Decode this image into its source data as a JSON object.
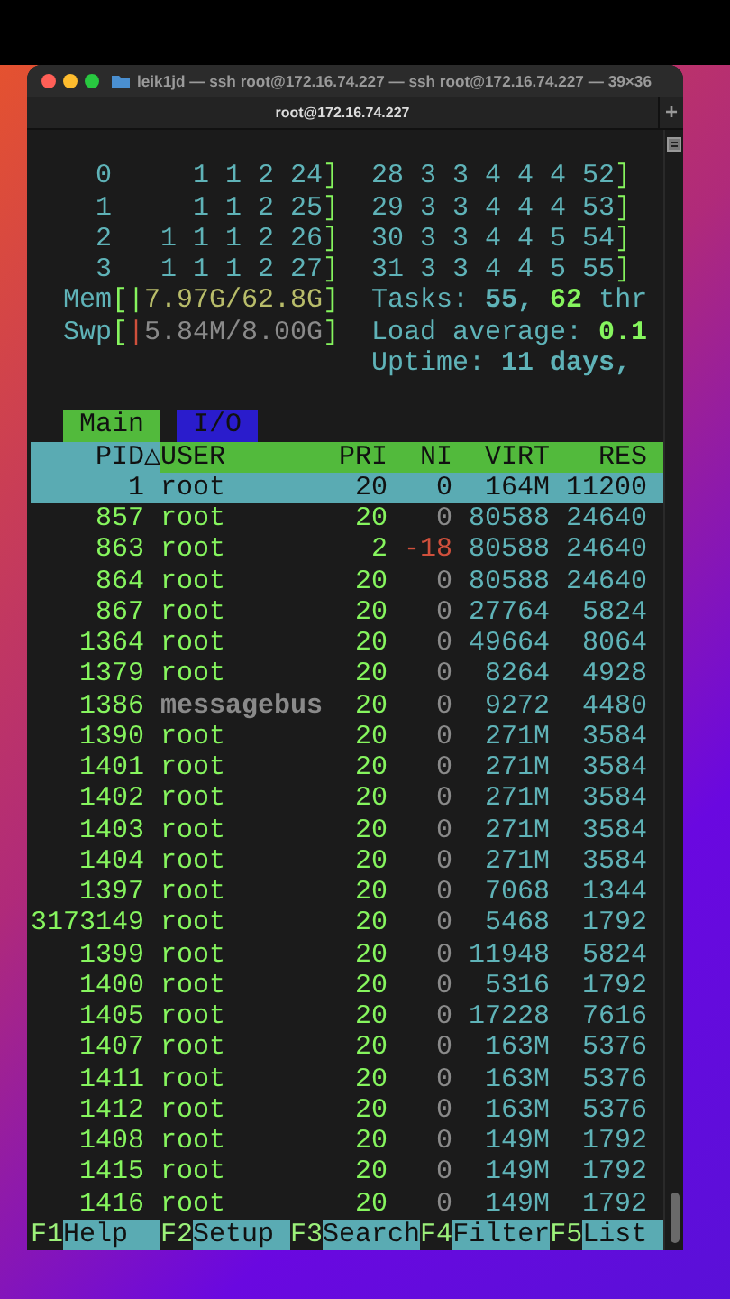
{
  "window": {
    "title": "leik1jd — ssh root@172.16.74.227 — ssh root@172.16.74.227 — 39×36",
    "tab_title": "root@172.16.74.227",
    "new_tab": "+"
  },
  "cpu_meters": [
    {
      "left": {
        "cpu": "0",
        "values": "1 1 2 24",
        "end": "]"
      },
      "right": {
        "values": "28 3 3 4 4 4 52",
        "end": "]"
      }
    },
    {
      "left": {
        "cpu": "1",
        "values": "1 1 2 25",
        "end": "]"
      },
      "right": {
        "values": "29 3 3 4 4 4 53",
        "end": "]"
      }
    },
    {
      "left": {
        "cpu": "2",
        "values": "1 1 1 2 26",
        "end": "]"
      },
      "right": {
        "values": "30 3 3 4 4 5 54",
        "end": "]"
      }
    },
    {
      "left": {
        "cpu": "3",
        "values": "1 1 1 2 27",
        "end": "]"
      },
      "right": {
        "values": "31 3 3 4 4 5 55",
        "end": "]"
      }
    }
  ],
  "memory": {
    "label": "Mem",
    "open": "[",
    "bar": "|",
    "value": "7.97G/62.8G",
    "close": "]"
  },
  "swap": {
    "label": "Swp",
    "open": "[",
    "bar": "|",
    "value": "5.84M/8.00G",
    "close": "]"
  },
  "tasks": {
    "label": "Tasks:",
    "count": "55,",
    "threads": "62",
    "unit": "thr"
  },
  "load": {
    "label": "Load average:",
    "value": "0.1"
  },
  "uptime": {
    "label": "Uptime:",
    "value": "11 days,"
  },
  "tabs": [
    {
      "label": "Main",
      "selected": true
    },
    {
      "label": "I/O",
      "selected": false
    }
  ],
  "columns": [
    {
      "label": "PID",
      "sort_mark": "△",
      "sorted": true
    },
    {
      "label": "USER",
      "sorted": false
    },
    {
      "label": "PRI",
      "sorted": false
    },
    {
      "label": "NI",
      "sorted": false
    },
    {
      "label": "VIRT",
      "sorted": false
    },
    {
      "label": "RES",
      "sorted": false
    }
  ],
  "rows": [
    {
      "pid": "1",
      "user": "root",
      "pri": "20",
      "ni": "0",
      "virt": "164M",
      "res": "11200",
      "selected": true,
      "dimmed_user": false,
      "reniced": false
    },
    {
      "pid": "857",
      "user": "root",
      "pri": "20",
      "ni": "0",
      "virt": "80588",
      "res": "24640",
      "selected": false,
      "dimmed_user": false,
      "reniced": false
    },
    {
      "pid": "863",
      "user": "root",
      "pri": "2",
      "ni": "-18",
      "virt": "80588",
      "res": "24640",
      "selected": false,
      "dimmed_user": false,
      "reniced": true
    },
    {
      "pid": "864",
      "user": "root",
      "pri": "20",
      "ni": "0",
      "virt": "80588",
      "res": "24640",
      "selected": false,
      "dimmed_user": false,
      "reniced": false
    },
    {
      "pid": "867",
      "user": "root",
      "pri": "20",
      "ni": "0",
      "virt": "27764",
      "res": "5824",
      "selected": false,
      "dimmed_user": false,
      "reniced": false
    },
    {
      "pid": "1364",
      "user": "root",
      "pri": "20",
      "ni": "0",
      "virt": "49664",
      "res": "8064",
      "selected": false,
      "dimmed_user": false,
      "reniced": false
    },
    {
      "pid": "1379",
      "user": "root",
      "pri": "20",
      "ni": "0",
      "virt": "8264",
      "res": "4928",
      "selected": false,
      "dimmed_user": false,
      "reniced": false
    },
    {
      "pid": "1386",
      "user": "messagebus",
      "pri": "20",
      "ni": "0",
      "virt": "9272",
      "res": "4480",
      "selected": false,
      "dimmed_user": true,
      "reniced": false
    },
    {
      "pid": "1390",
      "user": "root",
      "pri": "20",
      "ni": "0",
      "virt": "271M",
      "res": "3584",
      "selected": false,
      "dimmed_user": false,
      "reniced": false
    },
    {
      "pid": "1401",
      "user": "root",
      "pri": "20",
      "ni": "0",
      "virt": "271M",
      "res": "3584",
      "selected": false,
      "dimmed_user": false,
      "reniced": false
    },
    {
      "pid": "1402",
      "user": "root",
      "pri": "20",
      "ni": "0",
      "virt": "271M",
      "res": "3584",
      "selected": false,
      "dimmed_user": false,
      "reniced": false
    },
    {
      "pid": "1403",
      "user": "root",
      "pri": "20",
      "ni": "0",
      "virt": "271M",
      "res": "3584",
      "selected": false,
      "dimmed_user": false,
      "reniced": false
    },
    {
      "pid": "1404",
      "user": "root",
      "pri": "20",
      "ni": "0",
      "virt": "271M",
      "res": "3584",
      "selected": false,
      "dimmed_user": false,
      "reniced": false
    },
    {
      "pid": "1397",
      "user": "root",
      "pri": "20",
      "ni": "0",
      "virt": "7068",
      "res": "1344",
      "selected": false,
      "dimmed_user": false,
      "reniced": false
    },
    {
      "pid": "3173149",
      "user": "root",
      "pri": "20",
      "ni": "0",
      "virt": "5468",
      "res": "1792",
      "selected": false,
      "dimmed_user": false,
      "reniced": false
    },
    {
      "pid": "1399",
      "user": "root",
      "pri": "20",
      "ni": "0",
      "virt": "11948",
      "res": "5824",
      "selected": false,
      "dimmed_user": false,
      "reniced": false
    },
    {
      "pid": "1400",
      "user": "root",
      "pri": "20",
      "ni": "0",
      "virt": "5316",
      "res": "1792",
      "selected": false,
      "dimmed_user": false,
      "reniced": false
    },
    {
      "pid": "1405",
      "user": "root",
      "pri": "20",
      "ni": "0",
      "virt": "17228",
      "res": "7616",
      "selected": false,
      "dimmed_user": false,
      "reniced": false
    },
    {
      "pid": "1407",
      "user": "root",
      "pri": "20",
      "ni": "0",
      "virt": "163M",
      "res": "5376",
      "selected": false,
      "dimmed_user": false,
      "reniced": false
    },
    {
      "pid": "1411",
      "user": "root",
      "pri": "20",
      "ni": "0",
      "virt": "163M",
      "res": "5376",
      "selected": false,
      "dimmed_user": false,
      "reniced": false
    },
    {
      "pid": "1412",
      "user": "root",
      "pri": "20",
      "ni": "0",
      "virt": "163M",
      "res": "5376",
      "selected": false,
      "dimmed_user": false,
      "reniced": false
    },
    {
      "pid": "1408",
      "user": "root",
      "pri": "20",
      "ni": "0",
      "virt": "149M",
      "res": "1792",
      "selected": false,
      "dimmed_user": false,
      "reniced": false
    },
    {
      "pid": "1415",
      "user": "root",
      "pri": "20",
      "ni": "0",
      "virt": "149M",
      "res": "1792",
      "selected": false,
      "dimmed_user": false,
      "reniced": false
    },
    {
      "pid": "1416",
      "user": "root",
      "pri": "20",
      "ni": "0",
      "virt": "149M",
      "res": "1792",
      "selected": false,
      "dimmed_user": false,
      "reniced": false
    }
  ],
  "function_keys": [
    {
      "key": "F1",
      "label": "Help"
    },
    {
      "key": "F2",
      "label": "Setup"
    },
    {
      "key": "F3",
      "label": "Search"
    },
    {
      "key": "F4",
      "label": "Filter"
    },
    {
      "key": "F5",
      "label": "List"
    }
  ]
}
